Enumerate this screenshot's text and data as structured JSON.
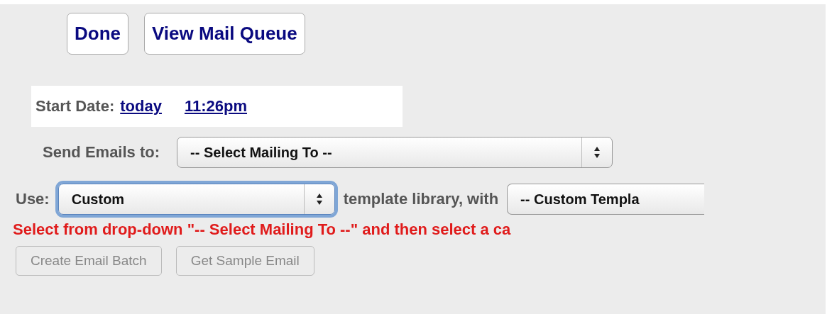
{
  "top_buttons": [
    {
      "label": "Done"
    },
    {
      "label": "View Mail Queue"
    }
  ],
  "start_date": {
    "label": "Start Date:",
    "date_link": "today",
    "time_link": "11:26pm"
  },
  "send_to": {
    "label": "Send Emails to:",
    "select": {
      "value": "-- Select Mailing To --",
      "focused": false
    }
  },
  "use_row": {
    "label": "Use:",
    "library_select": {
      "value": "Custom",
      "focused": true
    },
    "middle_text": "template library, with",
    "template_select": {
      "value": "-- Custom Templa",
      "focused": false
    }
  },
  "error_message": "Select from drop-down \"-- Select Mailing To --\" and then select a ca",
  "action_buttons": [
    {
      "label": "Create Email Batch",
      "disabled": true
    },
    {
      "label": "Get Sample Email",
      "disabled": true
    }
  ]
}
